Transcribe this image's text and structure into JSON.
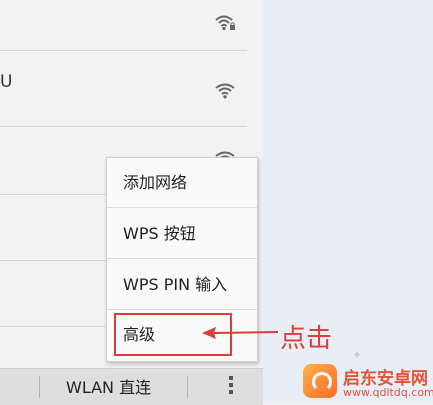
{
  "wifi_list": {
    "rows": [
      {
        "ssid": "",
        "secured": true
      },
      {
        "ssid": "U",
        "secured": false
      },
      {
        "ssid": "",
        "secured": false
      },
      {
        "ssid": "",
        "secured": false
      },
      {
        "ssid": "",
        "secured": false
      }
    ]
  },
  "overflow_menu": {
    "items": [
      {
        "label": "添加网络"
      },
      {
        "label": "WPS 按钮"
      },
      {
        "label": "WPS PIN 输入"
      },
      {
        "label": "高级"
      }
    ]
  },
  "bottom_bar": {
    "wlan_direct_label": "WLAN 直连"
  },
  "annotation": {
    "text": "点击",
    "color": "#d9403a"
  },
  "watermark": {
    "name": "启东安卓网",
    "url": "www.qdltdq.com"
  },
  "colors": {
    "accent_red": "#d9403a",
    "panel_right": "#e9edf6"
  },
  "icons": [
    "wifi-lock-icon",
    "wifi-icon",
    "menu-dots-icon",
    "arrow-icon"
  ]
}
